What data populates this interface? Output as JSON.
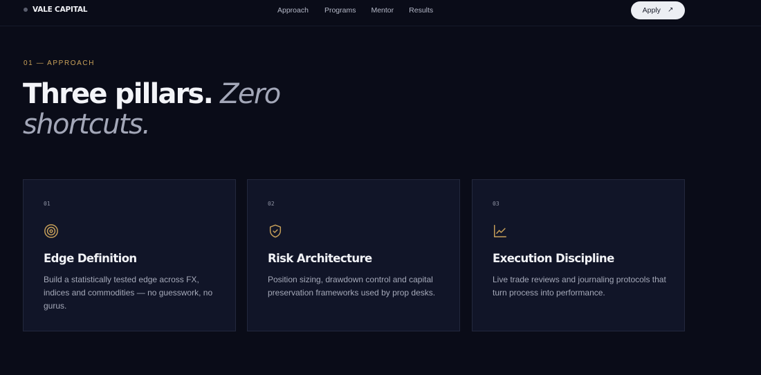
{
  "nav": {
    "brand": "VALE CAPITAL",
    "links": [
      "Approach",
      "Programs",
      "Mentor",
      "Results"
    ],
    "apply_label": "Apply",
    "apply_arrow": "↗"
  },
  "hero": {
    "eyebrow": "01 — APPROACH",
    "headline_strong": "Three pillars.",
    "headline_soft": "Zero shortcuts."
  },
  "cards": [
    {
      "num": "01",
      "icon": "target-icon",
      "title": "Edge Definition",
      "text": "Build a statistically tested edge across FX, indices and commodities — no guesswork, no gurus."
    },
    {
      "num": "02",
      "icon": "shield-check-icon",
      "title": "Risk Architecture",
      "text": "Position sizing, drawdown control and capital preservation frameworks used by prop desks."
    },
    {
      "num": "03",
      "icon": "line-chart-icon",
      "title": "Execution Discipline",
      "text": "Live trade reviews and journaling protocols that turn process into performance."
    }
  ],
  "colors": {
    "background": "#0a0c18",
    "card": "#111528",
    "accent_gold": "#c9a15a",
    "button_bg": "#eceef3"
  }
}
